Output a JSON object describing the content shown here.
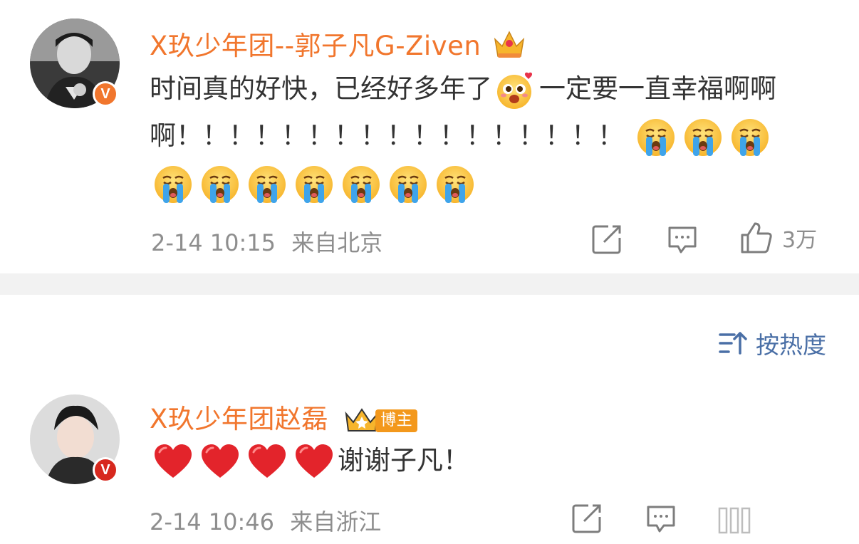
{
  "comments": [
    {
      "username": "X玖少年团--郭子凡G-Ziven",
      "text_part1": "时间真的好快，已经好多年了",
      "text_part2": "一定要一直幸福啊啊啊！！！！！！！！！！！！！！！！！",
      "timestamp": "2-14 10:15",
      "location": "来自北京",
      "likes": "3万",
      "verified_color": "#f1762d"
    },
    {
      "username": "X玖少年团赵磊",
      "badge": "博主",
      "text": "谢谢子凡！",
      "timestamp": "2-14 10:46",
      "location": "来自浙江",
      "verified_color": "#d7281e"
    }
  ],
  "sort": {
    "label": "按热度"
  },
  "icons": [
    "share-icon",
    "comment-icon",
    "like-icon",
    "sort-icon",
    "crown-icon",
    "cry-emoji",
    "love-emoji",
    "heart-emoji"
  ],
  "colors": {
    "username": "#f1762d",
    "meta": "#8e8e8e",
    "sort": "#4a6fa6",
    "divider": "#f2f2f2"
  }
}
